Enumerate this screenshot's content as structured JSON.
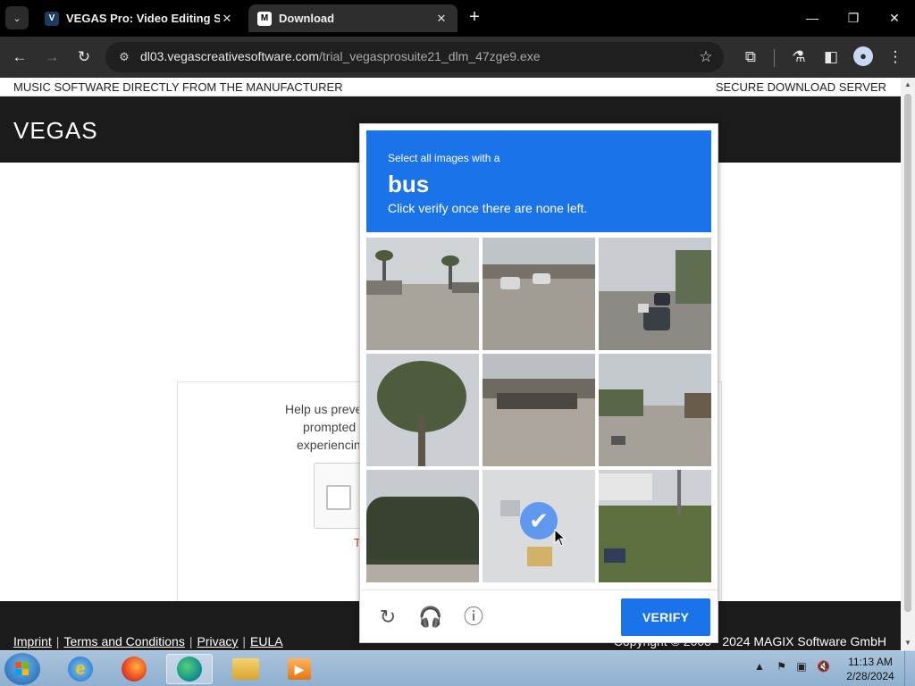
{
  "browser": {
    "tabs": [
      {
        "favicon": "V",
        "label": "VEGAS Pro: Video Editing Software",
        "close": "✕"
      },
      {
        "favicon": "M",
        "label": "Download",
        "close": "✕"
      }
    ],
    "new_tab": "+",
    "url_host": "dl03.vegascreativesoftware.com",
    "url_path": "/trial_vegasprosuite21_dlm_47zge9.exe"
  },
  "page": {
    "topbar_left": "MUSIC SOFTWARE DIRECTLY FROM THE MANUFACTURER",
    "topbar_right": "SECURE DOWNLOAD SERVER",
    "logo": "VEGAS",
    "verify_line1": "Help us preve",
    "verify_line2": "prompted",
    "verify_line3": "experiencin",
    "red_text": "T",
    "footer_links": [
      "Imprint",
      "Terms and Conditions",
      "Privacy",
      "EULA"
    ],
    "copyright": "Copyright © 2003 - 2024 MAGIX Software GmbH"
  },
  "captcha": {
    "line1": "Select all images with a",
    "target": "bus",
    "line3": "Click verify once there are none left.",
    "selected_tile": 8,
    "verify_label": "VERIFY",
    "icons": [
      "reload-icon",
      "audio-icon",
      "info-icon"
    ]
  },
  "taskbar": {
    "time": "11:13 AM",
    "date": "2/28/2024",
    "apps": [
      "internet-explorer-icon",
      "firefox-icon",
      "edge-icon",
      "file-explorer-icon",
      "media-player-icon"
    ]
  },
  "colors": {
    "captcha_blue": "#1a73e8",
    "header_dark": "#1b1b1b"
  }
}
